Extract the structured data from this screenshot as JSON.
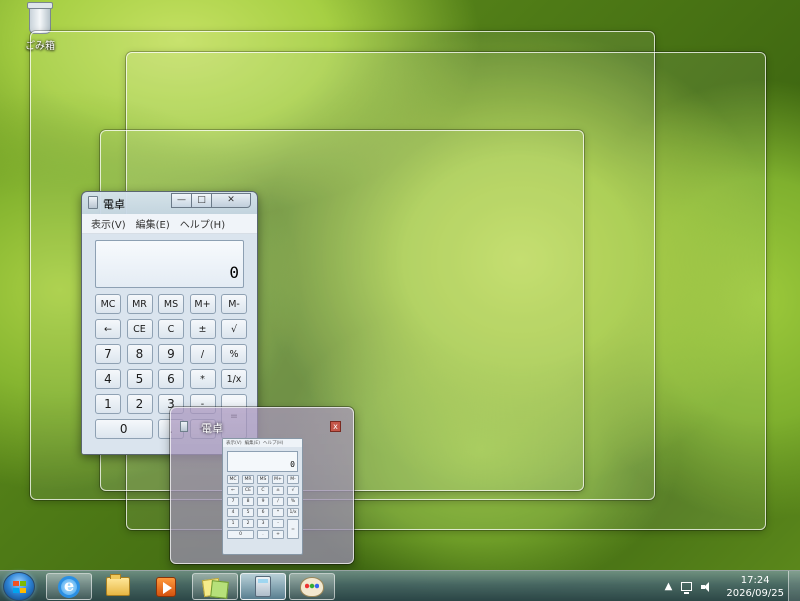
{
  "desktop": {
    "recycle_bin_label": "ごみ箱"
  },
  "calculator": {
    "title": "電卓",
    "menu": [
      "表示(V)",
      "編集(E)",
      "ヘルプ(H)"
    ],
    "display_value": "0",
    "caption_buttons": {
      "minimize": "—",
      "maximize": "□",
      "close": "✕"
    },
    "keys": [
      [
        "MC",
        "MR",
        "MS",
        "M+",
        "M-"
      ],
      [
        "←",
        "CE",
        "C",
        "±",
        "√"
      ],
      [
        "7",
        "8",
        "9",
        "/",
        "%"
      ],
      [
        "4",
        "5",
        "6",
        "*",
        "1/x"
      ],
      [
        "1",
        "2",
        "3",
        "-",
        "="
      ],
      [
        "0",
        ".",
        "+"
      ]
    ]
  },
  "thumbnail_preview": {
    "title": "電卓",
    "close_label": "x",
    "mini_menu": [
      "表示(V)",
      "編集(E)",
      "ヘルプ(H)"
    ],
    "mini_display": "0"
  },
  "taskbar": {
    "pinned": [
      {
        "name": "internet-explorer",
        "icon": "internet-explorer-icon"
      },
      {
        "name": "windows-explorer",
        "icon": "folder-icon"
      },
      {
        "name": "media-player",
        "icon": "media-player-icon"
      },
      {
        "name": "sticky-notes",
        "icon": "sticky-notes-icon"
      },
      {
        "name": "calculator",
        "icon": "calculator-icon"
      },
      {
        "name": "paint",
        "icon": "paint-icon"
      }
    ],
    "tray": {
      "show_hidden_label": "▲",
      "time": "17:24",
      "date": "2026/09/25"
    }
  }
}
